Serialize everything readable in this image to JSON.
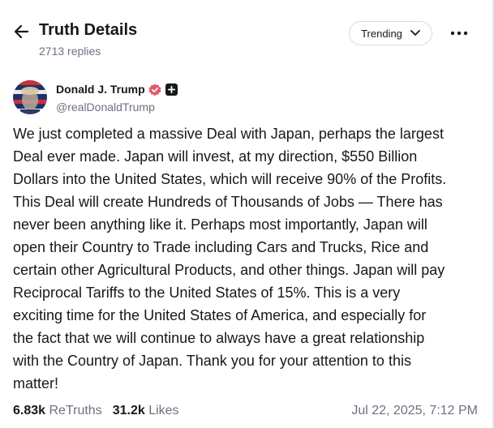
{
  "header": {
    "title": "Truth Details",
    "replies": "2713 replies",
    "sort_label": "Trending"
  },
  "author": {
    "name": "Donald J. Trump",
    "handle": "@realDonaldTrump"
  },
  "post": {
    "lines": [
      "We just completed a massive Deal with Japan, perhaps the largest",
      "Deal ever made. Japan will invest, at my direction, $550 Billion",
      "Dollars into the United States, which will receive 90% of the Profits.",
      "This Deal will create Hundreds of Thousands of Jobs — There has",
      "never been anything like it. Perhaps most importantly, Japan will",
      "open their Country to Trade including Cars and Trucks, Rice and",
      "certain other Agricultural Products, and other things. Japan will pay",
      "Reciprocal Tariffs to the United States of 15%. This is a very",
      "exciting time for the United States of America, and especially for",
      "the fact that we will continue to always have a great relationship",
      "with the Country of Japan. Thank you for your attention to this",
      "matter!"
    ]
  },
  "stats": {
    "retruths_count": "6.83k",
    "retruths_label": "ReTruths",
    "likes_count": "31.2k",
    "likes_label": "Likes",
    "timestamp": "Jul 22, 2025, 7:12 PM"
  },
  "icons": {
    "back": "back-arrow-icon",
    "chevron": "chevron-down-icon",
    "more": "more-dots-icon",
    "verified": "verified-badge-icon",
    "plus": "plus-badge-icon"
  },
  "colors": {
    "verified": "#e35a6b",
    "muted": "#6b7280",
    "text": "#16181c"
  }
}
